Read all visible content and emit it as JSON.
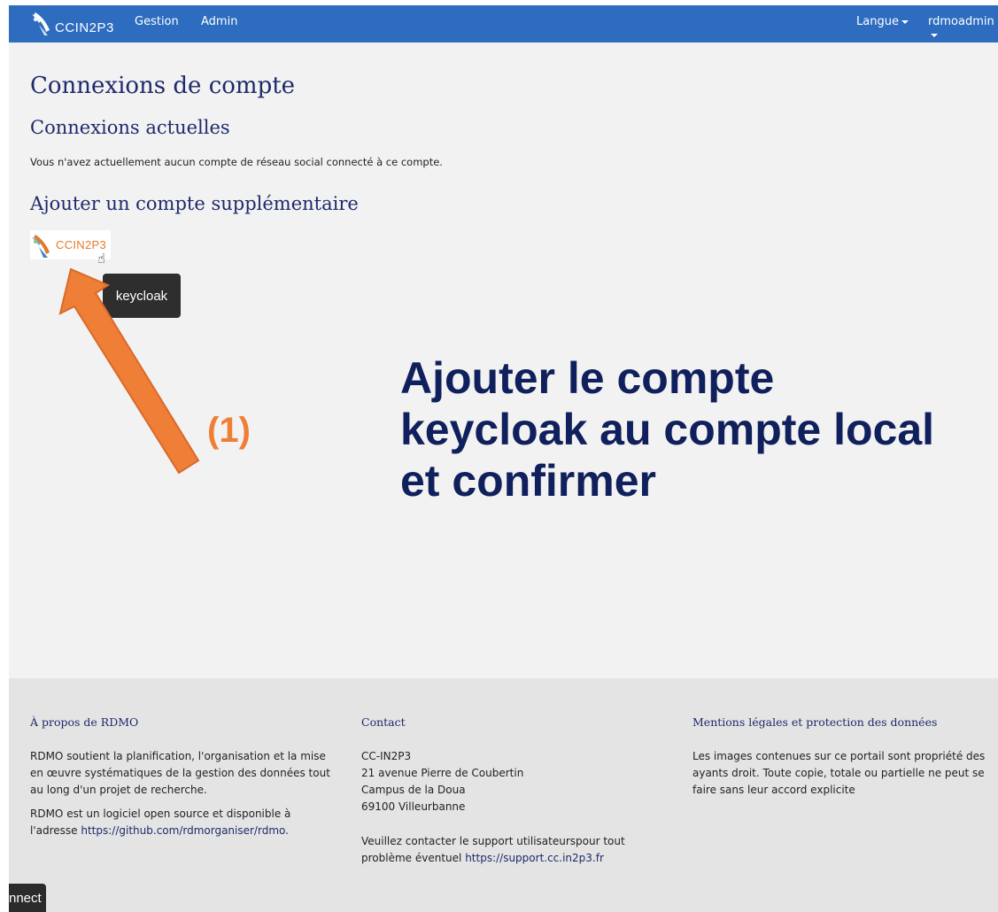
{
  "navbar": {
    "brand": "CCIN2P3",
    "links": [
      "Gestion",
      "Admin"
    ],
    "language": "Langue",
    "user": "rdmoadmin"
  },
  "content": {
    "title": "Connexions de compte",
    "current_heading": "Connexions actuelles",
    "current_text": "Vous n'avez actuellement aucun compte de réseau social connecté à ce compte.",
    "add_heading": "Ajouter un compte supplémentaire",
    "provider_logo_text": "CCIN2P3",
    "tooltip": "keycloak"
  },
  "annotation": {
    "step": "(1)",
    "lines": [
      "Ajouter le compte",
      "keycloak au compte local",
      "et confirmer"
    ],
    "arrow_color": "#ef7f36",
    "text_color": "#10205c"
  },
  "footer": {
    "about": {
      "heading": "À propos de RDMO",
      "p1": "RDMO soutient la planification, l'organisation et la mise en œuvre systématiques de la gestion des données tout au long d'un projet de recherche.",
      "p2_prefix": "RDMO est un logiciel open source et disponible à l'adresse",
      "p2_link": "https://github.com/rdmorganiser/rdmo."
    },
    "contact": {
      "heading": "Contact",
      "address": [
        "CC-IN2P3",
        "21 avenue Pierre de Coubertin",
        "Campus de la Doua",
        "69100 Villeurbanne"
      ],
      "support_prefix": "Veuillez contacter le support utilisateurspour tout problème éventuel",
      "support_link": "https://support.cc.in2p3.fr"
    },
    "legal": {
      "heading": "Mentions légales et protection des données",
      "text": "Les images contenues sur ce portail sont propriété des ayants droit. Toute copie, totale ou partielle ne peut se faire sans leur accord explicite"
    }
  },
  "connect_tab": "nnect"
}
